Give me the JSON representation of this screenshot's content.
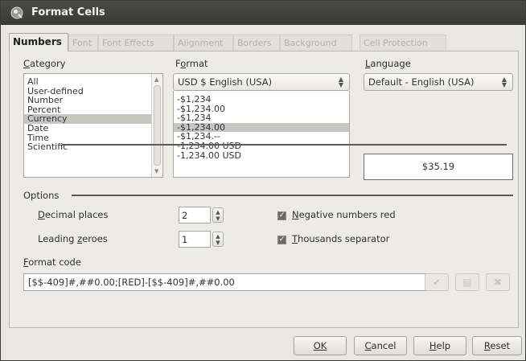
{
  "window": {
    "title": "Format Cells"
  },
  "tabs": [
    {
      "label": "Numbers",
      "active": true
    },
    {
      "label": "Font"
    },
    {
      "label": "Font Effects"
    },
    {
      "label": "Alignment"
    },
    {
      "label": "Borders"
    },
    {
      "label": "Background"
    },
    {
      "label": "Cell Protection"
    }
  ],
  "category": {
    "label_accel": "C",
    "label_rest": "ategory",
    "items": [
      "All",
      "User-defined",
      "Number",
      "Percent",
      "Currency",
      "Date",
      "Time",
      "Scientific"
    ],
    "selected": "Currency"
  },
  "format": {
    "label_pre": "F",
    "label_accel": "o",
    "label_rest": "rmat",
    "selected_currency": "USD  $  English (USA)",
    "items": [
      "-$1,234",
      "-$1,234.00",
      "-$1,234",
      "-$1,234.00",
      "-$1,234.--",
      "-1,234.00 USD",
      "-1,234.00 USD"
    ],
    "selected_index": 3
  },
  "language": {
    "label_accel": "L",
    "label_rest": "anguage",
    "value": "Default - English (USA)"
  },
  "preview": {
    "value": "$35.19"
  },
  "options": {
    "heading": "Options",
    "decimal_places": {
      "label_accel": "D",
      "label_rest": "ecimal places",
      "value": "2"
    },
    "leading_zeroes": {
      "label_pre": "Leading ",
      "label_accel": "z",
      "label_rest": "eroes",
      "value": "1"
    },
    "negative_red": {
      "label_accel": "N",
      "label_rest": "egative numbers red",
      "checked": true
    },
    "thousands_sep": {
      "label_accel": "T",
      "label_rest": "housands separator",
      "checked": true
    }
  },
  "format_code": {
    "label_accel": "F",
    "label_rest": "ormat code",
    "value": "[$$-409]#,##0.00;[RED]-[$$-409]#,##0.00"
  },
  "buttons": {
    "ok": "OK",
    "cancel_accel": "C",
    "cancel_rest": "ancel",
    "help_accel": "H",
    "help_rest": "elp",
    "reset_accel": "R",
    "reset_rest": "eset"
  },
  "colors": {
    "titlebar": "#3f3f3b",
    "dialog_bg": "#ecebe7",
    "selection": "#c7c6c1"
  }
}
